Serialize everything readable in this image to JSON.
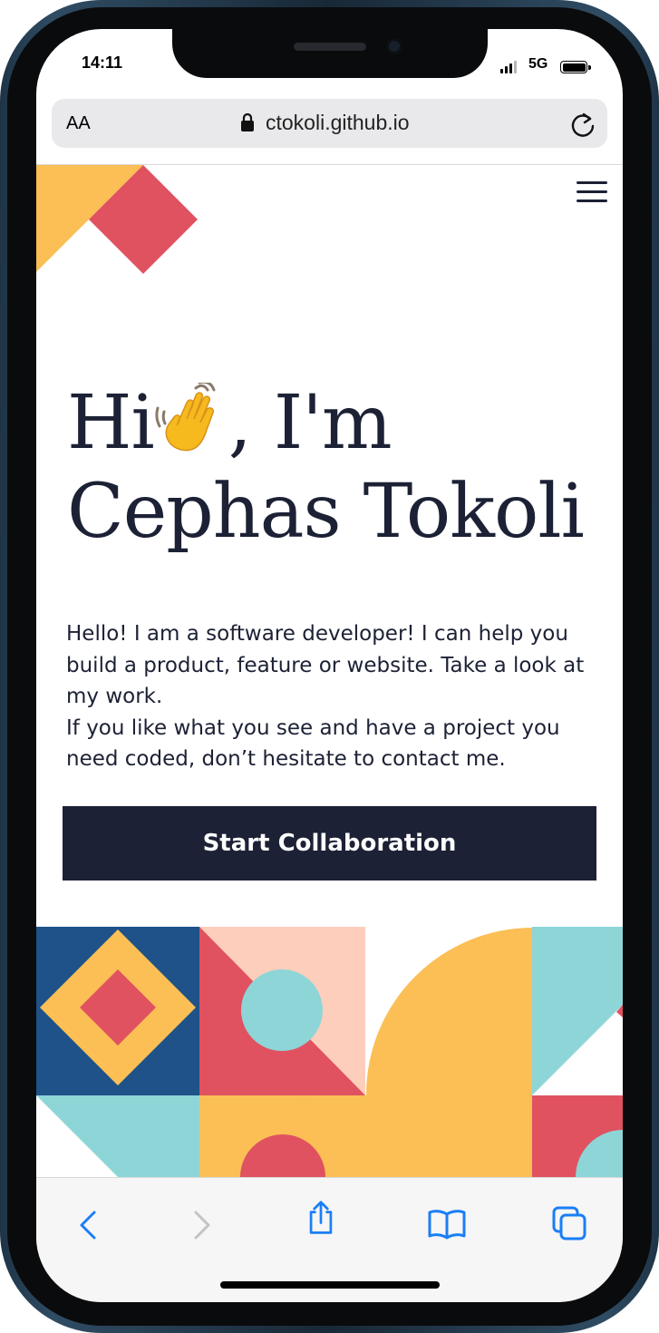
{
  "status_bar": {
    "time": "14:11",
    "network": "5G"
  },
  "browser": {
    "text_size_label": "AA",
    "url": "ctokoli.github.io"
  },
  "page": {
    "heading_line1_start": "Hi",
    "heading_line1_end": ", I'm",
    "heading_line2": "Cephas Tokoli",
    "emoji_icon": "waving-hand-icon",
    "intro_paragraph_1": "Hello! I am a software developer! I can help you build a product, feature or website. Take a look at my work.",
    "intro_paragraph_2": "If you like what you see and have a project you need coded, don’t hesitate to contact me.",
    "cta_label": "Start Collaboration"
  },
  "toolbar": {
    "icons": [
      "back-icon",
      "forward-icon",
      "share-icon",
      "bookmarks-icon",
      "tabs-icon"
    ]
  },
  "colors": {
    "text_dark": "#1c2135",
    "brand_yellow": "#fbbf55",
    "brand_red": "#e05260",
    "brand_blue": "#1e5288",
    "brand_teal": "#8ed5d8",
    "brand_peach": "#fecebc",
    "ios_blue": "#1a7ef6"
  }
}
